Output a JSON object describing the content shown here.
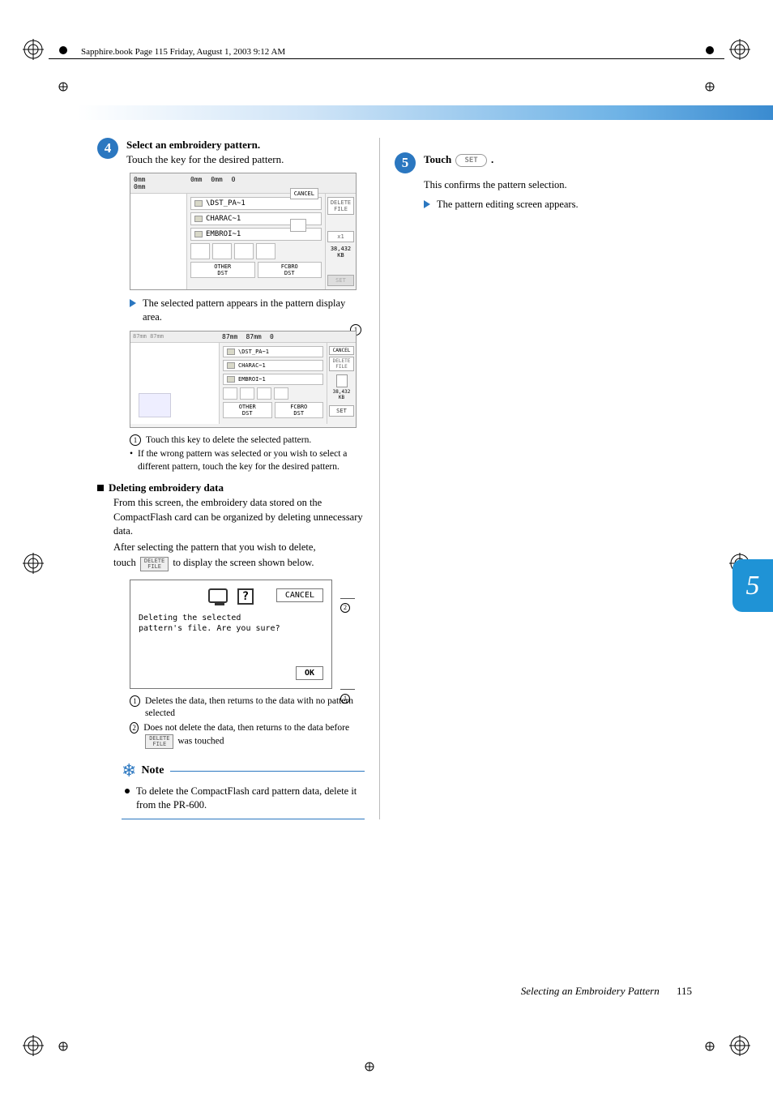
{
  "meta": {
    "header": "Sapphire.book  Page 115  Friday, August 1, 2003  9:12 AM"
  },
  "step4": {
    "num": "4",
    "title": "Select an embroidery pattern.",
    "sub": "Touch the key for the desired pattern."
  },
  "ui1": {
    "mm_h": "0mm",
    "mm_w": "0mm",
    "top_mm1": "0mm",
    "top_mm2": "0mm",
    "top_n": "0",
    "path": "\\DST_PA~1",
    "row_charac": "CHARAC~1",
    "row_embroi": "EMBROI~1",
    "bt_other": "OTHER",
    "bt_other2": "DST",
    "bt_fcbro": "FCBRO",
    "bt_fcbro2": "DST",
    "cancel": "CANCEL",
    "delete": "DELETE FILE",
    "x1": "x1",
    "kb": "38,432",
    "kb_unit": "KB",
    "set": "SET"
  },
  "after_sel": {
    "text": "The selected pattern appears in the pattern display area."
  },
  "ui2": {
    "dims": "87mm",
    "dims2": "87mm",
    "top_mm1": "87mm",
    "top_mm2": "87mm",
    "top_n": "0",
    "path": "\\DST_PA~1",
    "row_charac": "CHARAC~1",
    "row_embroi": "EMBROI~1",
    "bt_other": "OTHER",
    "bt_other2": "DST",
    "bt_fcbro": "FCBRO",
    "bt_fcbro2": "DST",
    "cancel": "CANCEL",
    "delete": "DELETE FILE",
    "kb": "38,432",
    "kb_unit": "KB",
    "set": "SET",
    "marker1": "1"
  },
  "anno2": {
    "l1_num": "1",
    "l1": "Touch this key to delete the selected pattern.",
    "l2_bullet": "•",
    "l2": "If the wrong pattern was selected or you wish to select a different pattern, touch the key for the desired pattern."
  },
  "delete_section": {
    "head": "Deleting embroidery data",
    "p1": "From this screen, the embroidery data stored on the CompactFlash card can be organized by deleting unnecessary data.",
    "p2a": "After selecting the pattern that you wish to delete,",
    "p2b": "touch ",
    "p2_btn_top": "DELETE",
    "p2_btn_bot": "FILE",
    "p2c": " to display the screen shown below."
  },
  "dialog": {
    "msg1": "Deleting the selected",
    "msg2": "pattern's file. Are you sure?",
    "cancel": "CANCEL",
    "ok": "OK",
    "marker1": "1",
    "marker2": "2"
  },
  "anno3": {
    "l1_num": "1",
    "l1": "Deletes the data, then returns to the data with no pattern selected",
    "l2_num": "2",
    "l2a": "Does not delete the data, then returns to the data before ",
    "l2_btn_top": "DELETE",
    "l2_btn_bot": "FILE",
    "l2b": " was touched"
  },
  "note": {
    "label": "Note",
    "body": "To delete the CompactFlash card pattern data, delete it from the PR-600."
  },
  "step5": {
    "num": "5",
    "title_a": "Touch ",
    "set_label": "SET",
    "title_b": ".",
    "p1": "This confirms the pattern selection.",
    "p2": "The pattern editing screen appears."
  },
  "sidetab": "5",
  "footer": {
    "title": "Selecting an Embroidery Pattern",
    "page": "115"
  }
}
